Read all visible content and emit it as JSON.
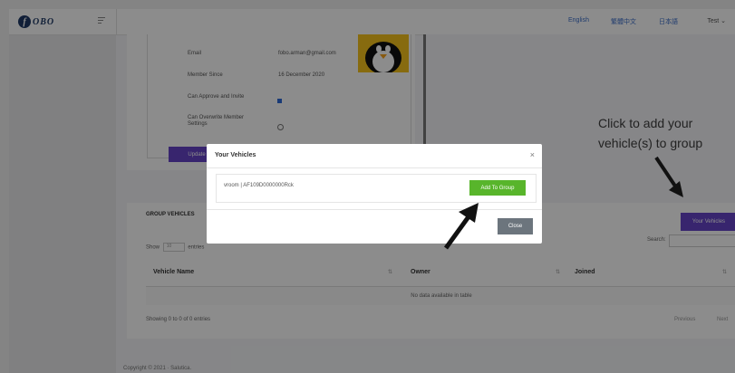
{
  "header": {
    "logo_text": "OBO",
    "logo_letter": "f",
    "languages": [
      "English",
      "繁體中文",
      "日本語"
    ],
    "user": "Test"
  },
  "member": {
    "email_label": "Email",
    "email_value": "fobo.arman@gmail.com",
    "since_label": "Member Since",
    "since_value": "16 December 2020",
    "approve_label": "Can Approve and Invite",
    "approve_checked": true,
    "overwrite_label": "Can Overwrite Member Settings",
    "overwrite_checked": false,
    "update_label": "Update"
  },
  "annotation": {
    "line1": "Click to add your",
    "line2": "vehicle(s) to group"
  },
  "group_vehicles": {
    "title": "GROUP VEHICLES",
    "your_vehicles_label": "Your Vehicles",
    "show_label": "Show",
    "entries_value": "10",
    "entries_label": "entries",
    "search_label": "Search:",
    "columns": [
      "Vehicle Name",
      "Owner",
      "Joined"
    ],
    "no_data": "No data available in table",
    "info": "Showing 0 to 0 of 0 entries",
    "previous": "Previous",
    "next": "Next"
  },
  "footer": {
    "copyright": "Copyright © 2021 · Salutica."
  },
  "modal": {
    "title": "Your Vehicles",
    "close_symbol": "×",
    "vehicle_label": "vroom | AF109D0000000Rck",
    "add_button": "Add To Group",
    "close_button": "Close"
  },
  "colors": {
    "accent_purple": "#6644c8",
    "add_green": "#58b52b",
    "danger_red": "#d93a3a"
  }
}
